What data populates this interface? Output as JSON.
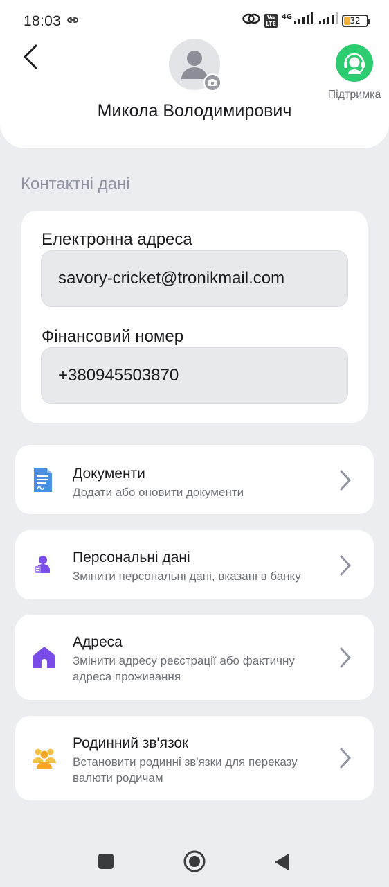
{
  "status_bar": {
    "time": "18:03",
    "network": "4G",
    "volte": "VoLTE",
    "battery": "32"
  },
  "header": {
    "user_name": "Микола Володимирович",
    "support_label": "Підтримка"
  },
  "contacts": {
    "section_title": "Контактні дані",
    "email_label": "Електронна адреса",
    "email_value": "savory-cricket@tronikmail.com",
    "phone_label": "Фінансовий номер",
    "phone_value": "+380945503870"
  },
  "menu": [
    {
      "title": "Документи",
      "subtitle": "Додати або оновити документи",
      "icon": "document-icon"
    },
    {
      "title": "Персональні дані",
      "subtitle": "Змінити персональні дані, вказані в банку",
      "icon": "personal-data-icon"
    },
    {
      "title": "Адреса",
      "subtitle": "Змінити адресу реєстрації або фактичну адреса проживання",
      "icon": "home-icon"
    },
    {
      "title": "Родинний зв'язок",
      "subtitle": "Встановити родинні зв'язки для переказу валюти родичам",
      "icon": "family-icon"
    }
  ],
  "colors": {
    "background": "#ECEDF1",
    "support_green": "#2ECC71",
    "doc_blue": "#4A90E2",
    "purple": "#7B4DE8",
    "family_yellow": "#F7C24A"
  }
}
